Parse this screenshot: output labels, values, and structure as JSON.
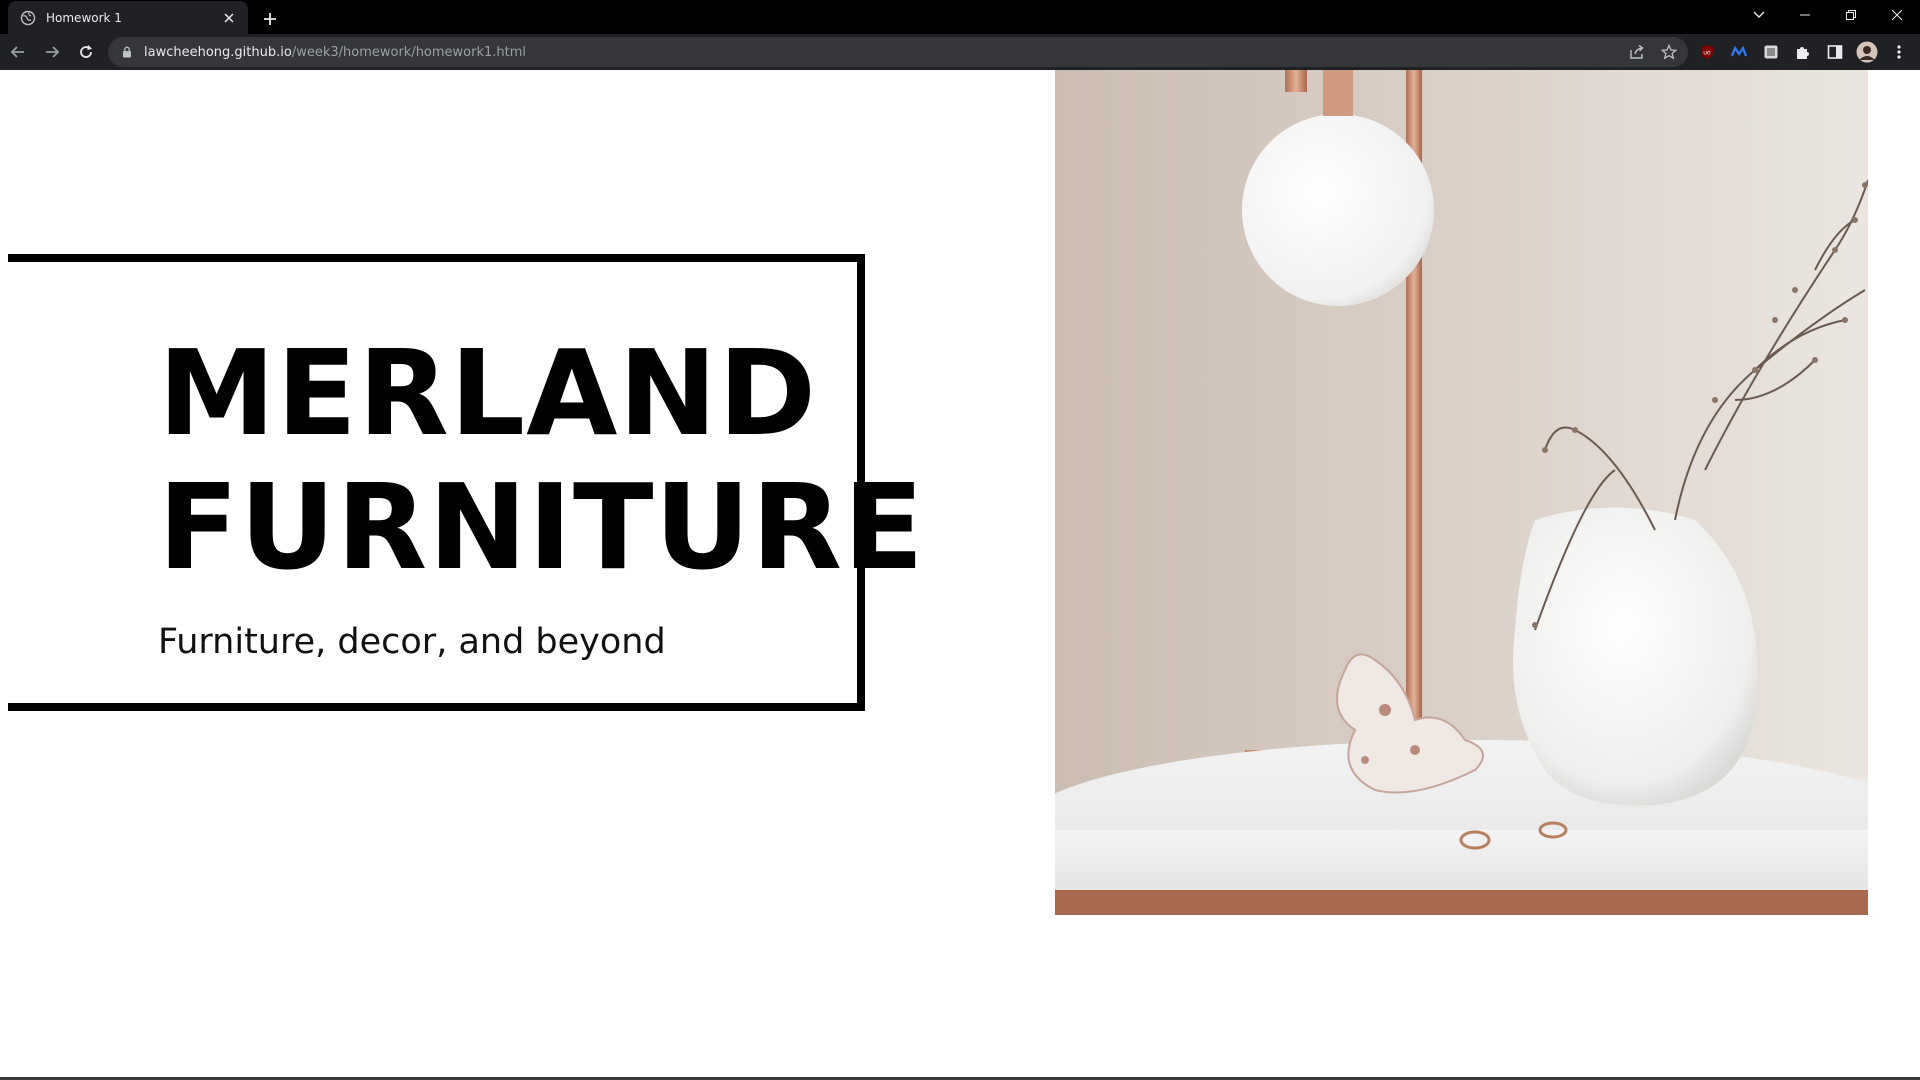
{
  "browser": {
    "tab_title": "Homework 1",
    "new_tab_label": "+",
    "url_host": "lawcheehong.github.io",
    "url_path": "/week3/homework/homework1.html"
  },
  "page": {
    "brand_line1": "MERLAND",
    "brand_line2": "FURNITURE",
    "tagline": "Furniture, decor, and beyond",
    "hero_image_alt": "White globe lamp, white vase with dried branches and coral on a marble side table"
  },
  "colors": {
    "chrome_dark": "#202124",
    "titlebar": "#000000",
    "border": "#000000",
    "copper": "#c98a6a"
  }
}
